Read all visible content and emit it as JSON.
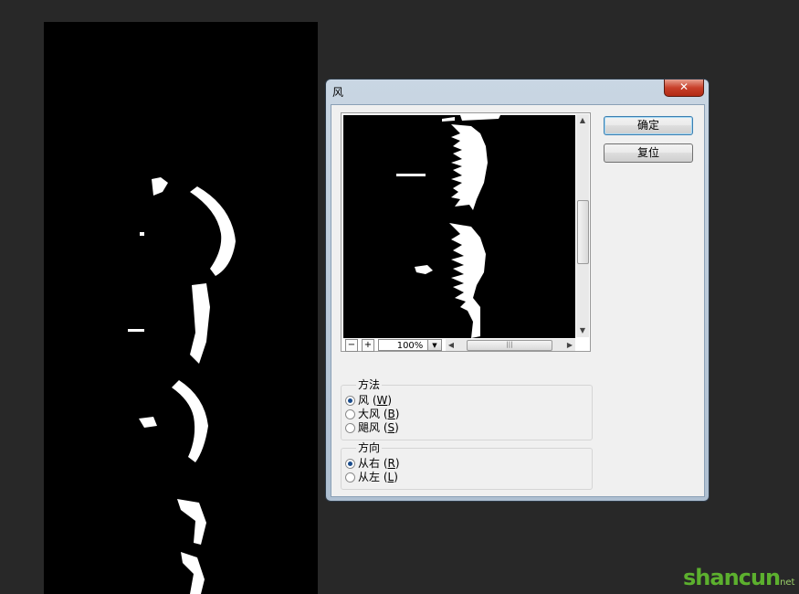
{
  "dialog": {
    "title": "风",
    "close_label": "✕",
    "ok_label": "确定",
    "reset_label": "复位",
    "zoom_level": "100%",
    "zoom_out_label": "−",
    "zoom_in_label": "+"
  },
  "method": {
    "label": "方法",
    "options": [
      {
        "text": "风",
        "key": "W",
        "selected": true
      },
      {
        "text": "大风",
        "key": "B",
        "selected": false
      },
      {
        "text": "飓风",
        "key": "S",
        "selected": false
      }
    ]
  },
  "direction": {
    "label": "方向",
    "options": [
      {
        "text": "从右",
        "key": "R",
        "selected": true
      },
      {
        "text": "从左",
        "key": "L",
        "selected": false
      }
    ]
  },
  "watermark": {
    "brand": "shancun",
    "suffix": "net"
  },
  "colors": {
    "app_bg": "#282828",
    "canvas_bg": "#000000",
    "close_red": "#c8402a",
    "radio_dot": "#1a4c8c"
  }
}
